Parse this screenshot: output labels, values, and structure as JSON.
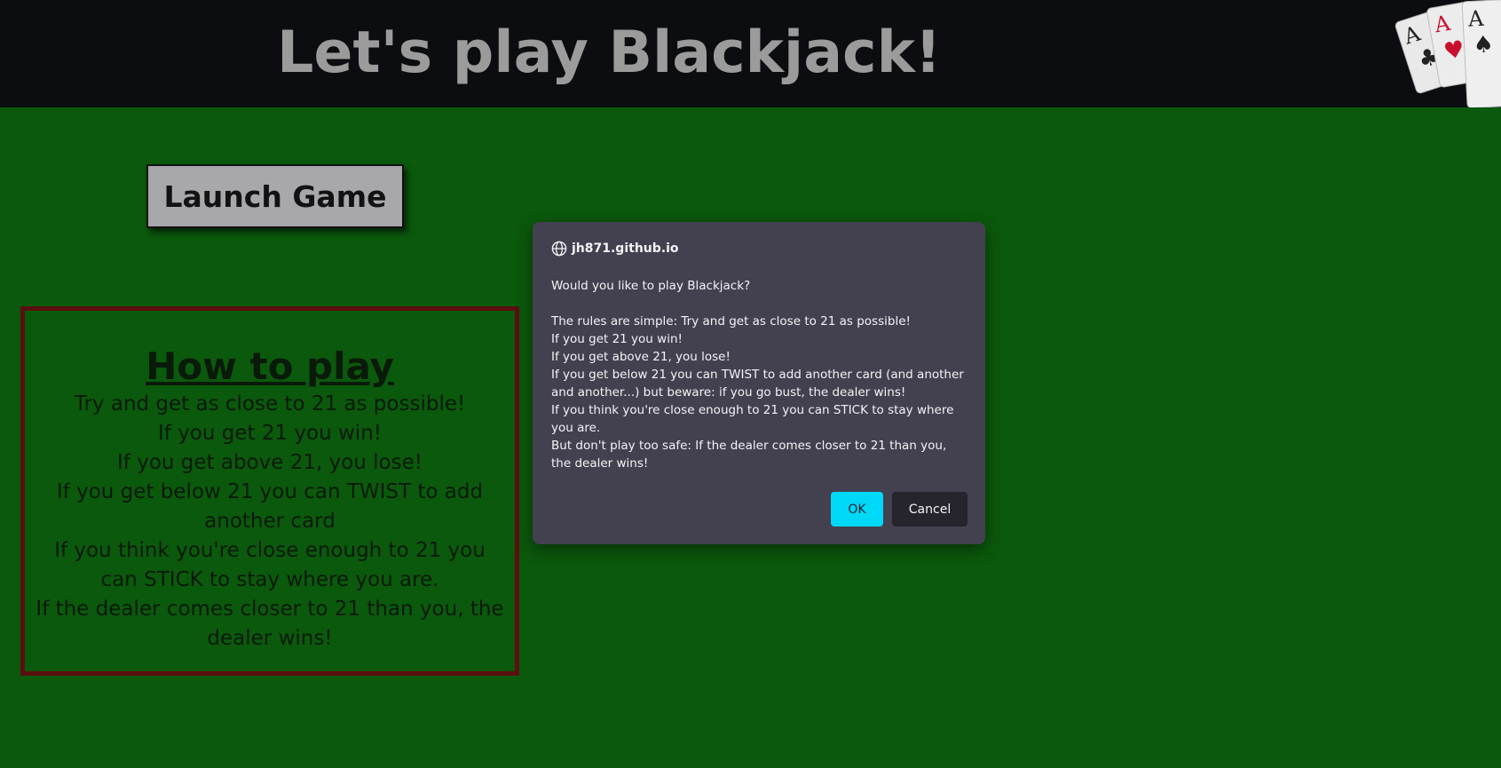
{
  "header": {
    "title": "Let's play Blackjack!",
    "logo_cards": [
      "A",
      "A",
      "A"
    ],
    "logo_icon": "three-aces-icon"
  },
  "launch_button": {
    "label": "Launch Game"
  },
  "how_to_play": {
    "title": "How to play",
    "lines": [
      "Try and get as close to 21 as possible!",
      "If you get 21 you win!",
      "If you get above 21, you lose!",
      "If you get below 21 you can TWIST to add another card",
      "If you think you're close enough to 21 you can STICK to stay where you are.",
      "If the dealer comes closer to 21 than you, the dealer wins!"
    ]
  },
  "dialog": {
    "origin": "jh871.github.io",
    "origin_icon": "globe-icon",
    "question": "Would you like to play Blackjack?",
    "rules": [
      "The rules are simple: Try and get as close to 21 as possible!",
      "If you get 21 you win!",
      "If you get above 21, you lose!",
      "If you get below 21 you can TWIST to add another card (and another and another...) but beware: if you go bust, the dealer wins!",
      "If you think you're close enough to 21 you can STICK to stay where you are.",
      "But don't play too safe: If the dealer comes closer to 21 than you, the dealer wins!"
    ],
    "ok_label": "OK",
    "cancel_label": "Cancel"
  },
  "colors": {
    "table_green": "#0b590c",
    "header_bg": "#0c0d10",
    "title_grey": "#9b9b9b",
    "box_border": "#5c0f0f",
    "dialog_bg": "#434150",
    "ok_accent": "#00d8f7",
    "card_red": "#c8102e"
  }
}
